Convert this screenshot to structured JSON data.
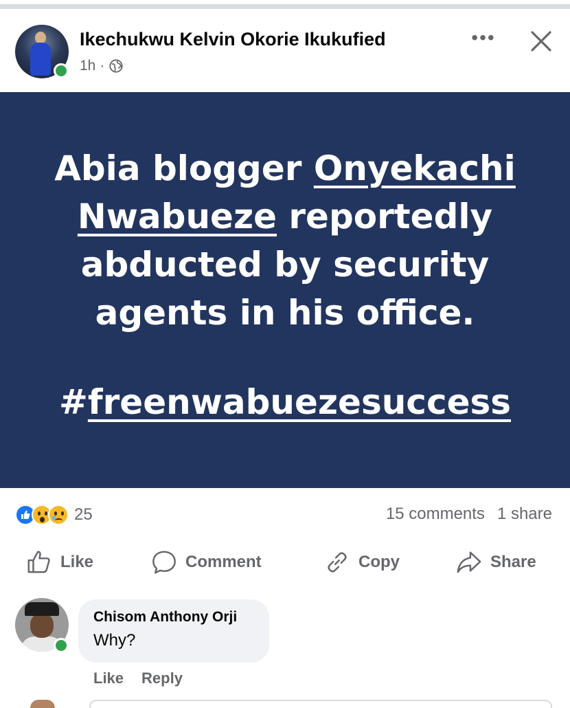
{
  "post": {
    "author": "Ikechukwu Kelvin Okorie Ikukufied",
    "time": "1h",
    "separator": "·",
    "more_icon": "more-horizontal-icon",
    "more_label": "•••",
    "close_icon": "close-icon",
    "image": {
      "background": "#22355e",
      "headline_part1": "Abia blogger ",
      "headline_link": "Onyekachi Nwabueze",
      "headline_part2": " reportedly abducted by security agents in his office.",
      "hashtag_symbol": "#",
      "hashtag_text": "freenwabuezesuccess"
    }
  },
  "engagement": {
    "reactions": [
      "like",
      "wow",
      "sad"
    ],
    "reaction_count": "25",
    "comments": "15 comments",
    "shares": "1 share"
  },
  "actions": [
    {
      "label": "Like",
      "icon": "thumbs-up-icon"
    },
    {
      "label": "Comment",
      "icon": "comment-bubble-icon"
    },
    {
      "label": "Copy",
      "icon": "link-icon"
    },
    {
      "label": "Share",
      "icon": "share-arrow-icon"
    }
  ],
  "comment": {
    "author": "Chisom Anthony Orji",
    "text": "Why?",
    "like_label": "Like",
    "reply_label": "Reply"
  },
  "colors": {
    "accent": "#1877f2",
    "online": "#31a24c",
    "muted_text": "#65676b",
    "bubble": "#f0f2f5"
  }
}
